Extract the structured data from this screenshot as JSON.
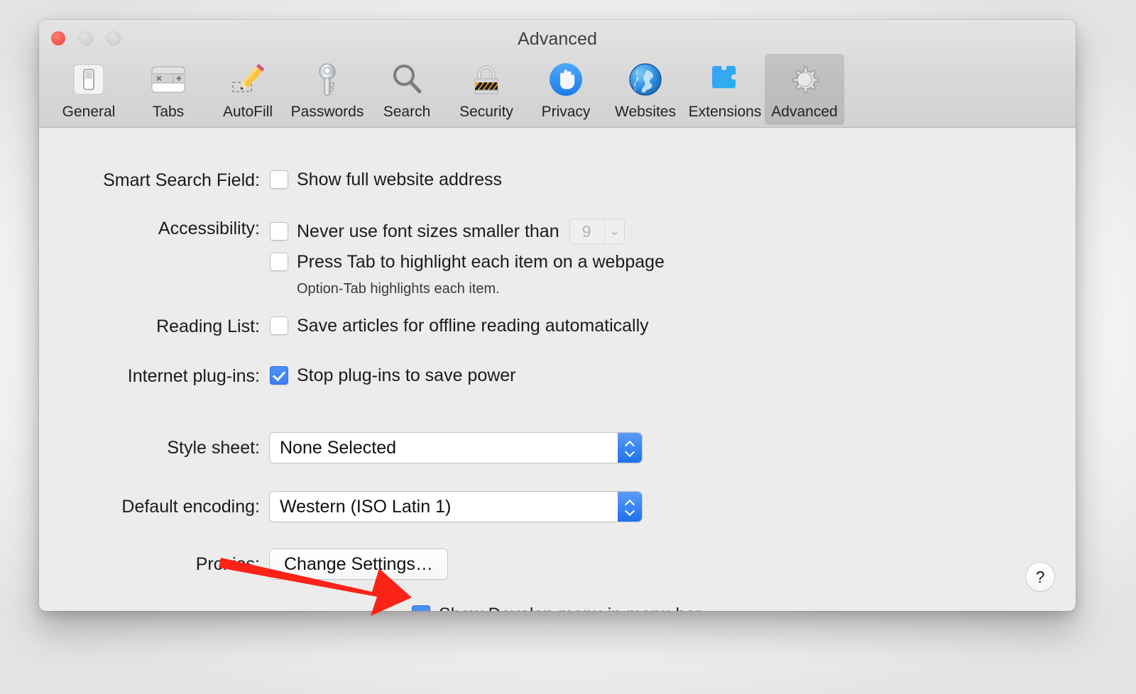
{
  "window": {
    "title": "Advanced",
    "controls": [
      {
        "name": "close",
        "color": "#f9564d"
      },
      {
        "name": "minimize",
        "color": "#d4d4d4"
      },
      {
        "name": "zoom",
        "color": "#d4d4d4"
      }
    ]
  },
  "toolbar": {
    "items": [
      {
        "id": "general",
        "label": "General",
        "icon": "general-switch-icon",
        "selected": false
      },
      {
        "id": "tabs",
        "label": "Tabs",
        "icon": "tabs-icon",
        "selected": false
      },
      {
        "id": "autofill",
        "label": "AutoFill",
        "icon": "pencil-icon",
        "selected": false
      },
      {
        "id": "passwords",
        "label": "Passwords",
        "icon": "key-icon",
        "selected": false
      },
      {
        "id": "search",
        "label": "Search",
        "icon": "magnifier-icon",
        "selected": false
      },
      {
        "id": "security",
        "label": "Security",
        "icon": "padlock-icon",
        "selected": false
      },
      {
        "id": "privacy",
        "label": "Privacy",
        "icon": "hand-icon",
        "selected": false
      },
      {
        "id": "websites",
        "label": "Websites",
        "icon": "globe-icon",
        "selected": false
      },
      {
        "id": "extensions",
        "label": "Extensions",
        "icon": "puzzle-compass-icon",
        "selected": false
      },
      {
        "id": "advanced",
        "label": "Advanced",
        "icon": "gear-icon",
        "selected": true
      }
    ]
  },
  "settings": {
    "smart_search": {
      "label": "Smart Search Field:",
      "checkbox_label": "Show full website address",
      "checked": false
    },
    "accessibility": {
      "label": "Accessibility:",
      "min_font": {
        "checkbox_label": "Never use font sizes smaller than",
        "checked": false,
        "value": "9",
        "disabled": true
      },
      "press_tab": {
        "checkbox_label": "Press Tab to highlight each item on a webpage",
        "checked": false
      },
      "hint": "Option-Tab highlights each item."
    },
    "reading_list": {
      "label": "Reading List:",
      "checkbox_label": "Save articles for offline reading automatically",
      "checked": false
    },
    "internet_plugins": {
      "label": "Internet plug-ins:",
      "checkbox_label": "Stop plug-ins to save power",
      "checked": true
    },
    "style_sheet": {
      "label": "Style sheet:",
      "value": "None Selected"
    },
    "default_encoding": {
      "label": "Default encoding:",
      "value": "Western (ISO Latin 1)"
    },
    "proxies": {
      "label": "Proxies:",
      "button_label": "Change Settings…"
    },
    "develop_menu": {
      "checkbox_label": "Show Develop menu in menu bar",
      "checked": true
    }
  },
  "help_button": {
    "glyph": "?"
  },
  "annotation": {
    "type": "arrow",
    "color": "#fb2318",
    "points_to": "show-develop-menu-checkbox"
  },
  "colors": {
    "accent_checkbox": "#4285f4",
    "popup_arrow": "#1d72ee",
    "window_bg": "#ececec",
    "toolbar_bg": "#d8d8d8",
    "annotation_red": "#fb2318"
  }
}
